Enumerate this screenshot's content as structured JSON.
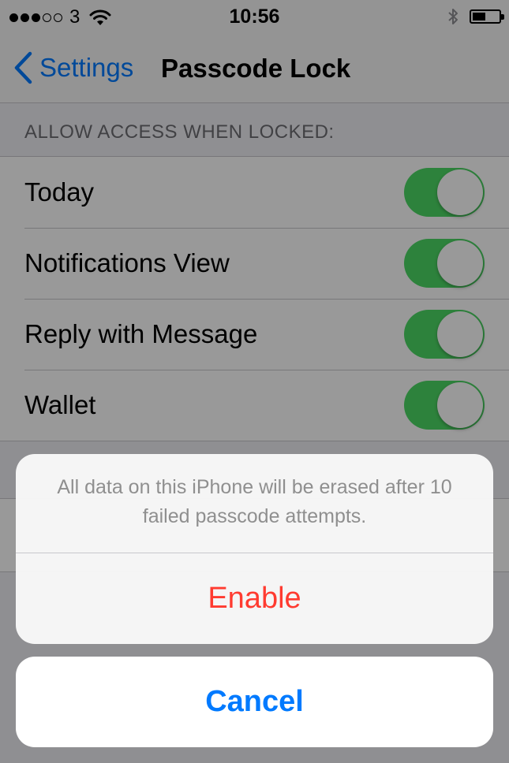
{
  "status_bar": {
    "carrier": "3",
    "time": "10:56",
    "signal_bars_filled": 3,
    "signal_bars_total": 5,
    "battery_level": 0.5
  },
  "nav": {
    "back_label": "Settings",
    "title": "Passcode Lock"
  },
  "section": {
    "header": "ALLOW ACCESS WHEN LOCKED:",
    "items": [
      {
        "label": "Today",
        "enabled": true
      },
      {
        "label": "Notifications View",
        "enabled": true
      },
      {
        "label": "Reply with Message",
        "enabled": true
      },
      {
        "label": "Wallet",
        "enabled": true
      }
    ]
  },
  "action_sheet": {
    "message": "All data on this iPhone will be erased after 10 failed passcode attempts.",
    "destructive_label": "Enable",
    "cancel_label": "Cancel"
  },
  "colors": {
    "toggle_on": "#4cd964",
    "destructive": "#ff3b30",
    "accent": "#007aff"
  },
  "icons": [
    "wifi-icon",
    "bluetooth-icon",
    "battery-icon",
    "chevron-left-icon"
  ]
}
